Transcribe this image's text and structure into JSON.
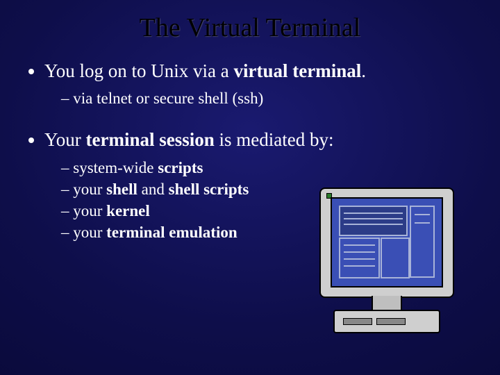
{
  "title": "The Virtual Terminal",
  "bullets": [
    {
      "pre": "You log on to Unix via a ",
      "bold": "virtual terminal",
      "post": ".",
      "sub": [
        {
          "pre": "via telnet or secure shell (ssh)",
          "bold": "",
          "post": ""
        }
      ]
    },
    {
      "pre": "Your ",
      "bold": "terminal session",
      "post": " is mediated by:",
      "sub": [
        {
          "pre": "system-wide ",
          "bold": "scripts",
          "post": ""
        },
        {
          "pre": "your ",
          "bold": "shell",
          "mid": " and ",
          "bold2": "shell scripts",
          "post": ""
        },
        {
          "pre": "your ",
          "bold": "kernel",
          "post": ""
        },
        {
          "pre": "your ",
          "bold": "terminal emulation",
          "post": ""
        }
      ]
    }
  ]
}
